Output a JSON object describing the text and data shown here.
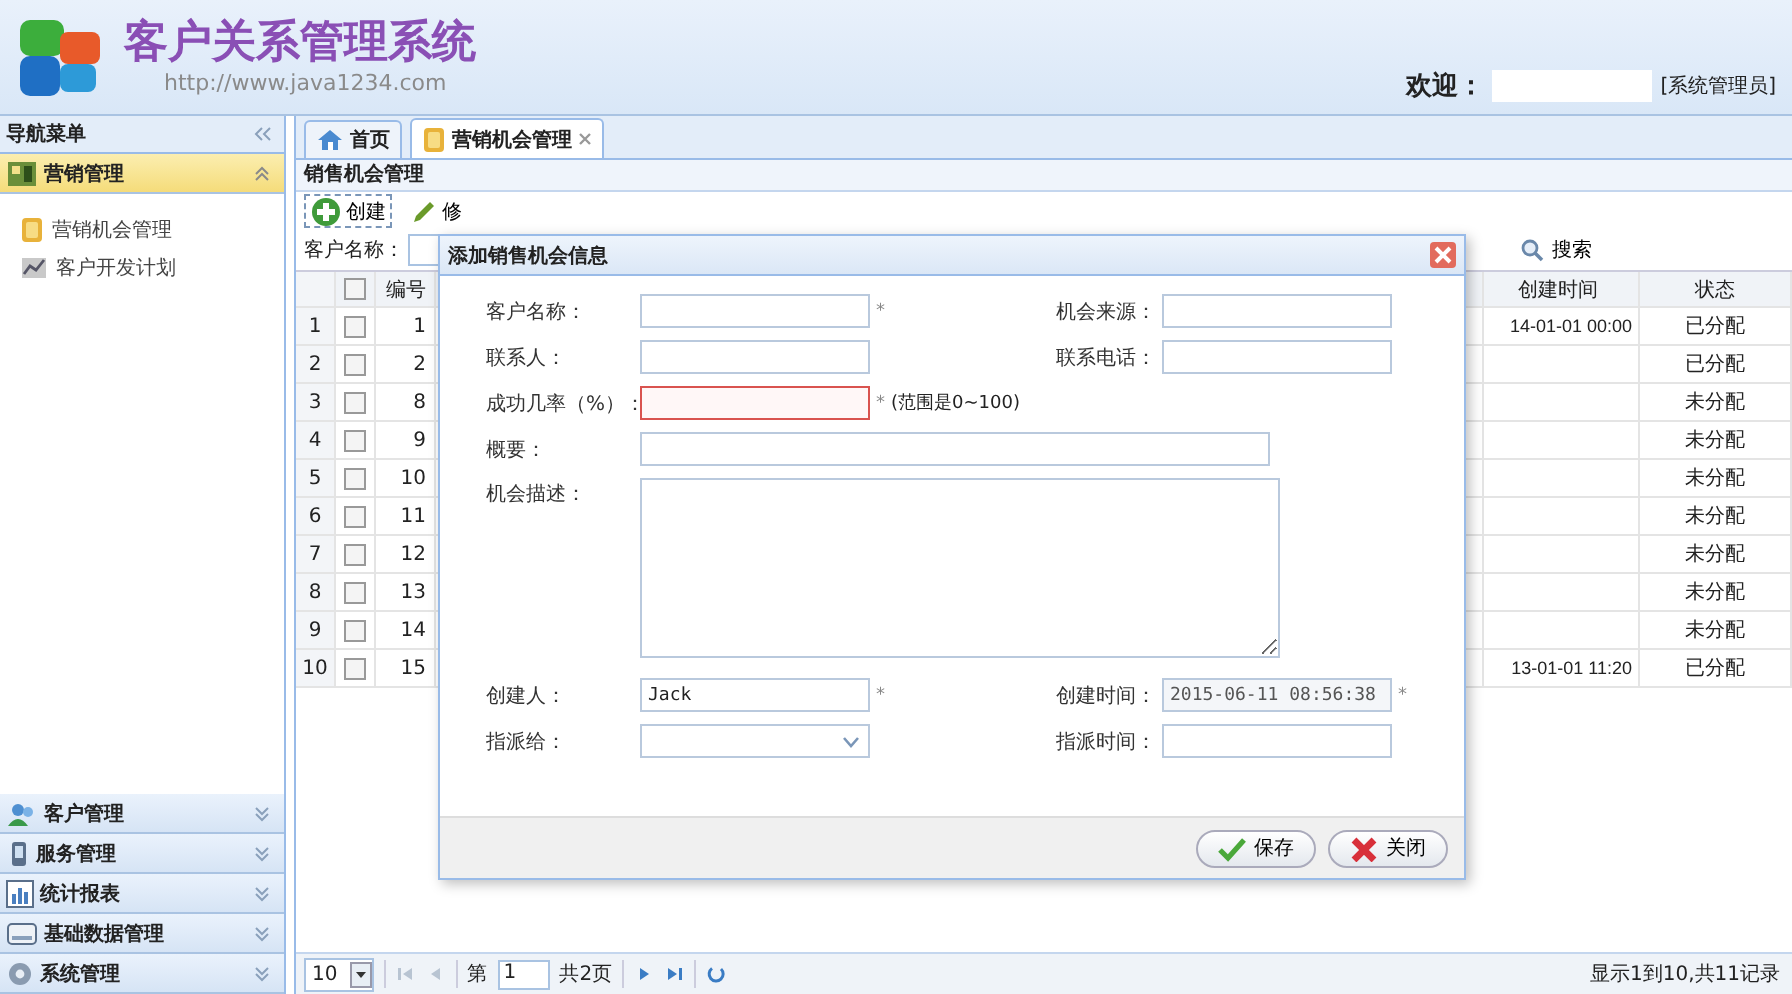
{
  "header": {
    "title": "客户关系管理系统",
    "url": "http://www.java1234.com",
    "welcome_label": "欢迎：",
    "user_role": "[系统管理员]"
  },
  "sidebar": {
    "title": "导航菜单",
    "sections": [
      {
        "label": "营销管理",
        "expanded": true,
        "items": [
          {
            "label": "营销机会管理"
          },
          {
            "label": "客户开发计划"
          }
        ]
      },
      {
        "label": "客户管理",
        "expanded": false
      },
      {
        "label": "服务管理",
        "expanded": false
      },
      {
        "label": "统计报表",
        "expanded": false
      },
      {
        "label": "基础数据管理",
        "expanded": false
      },
      {
        "label": "系统管理",
        "expanded": false
      }
    ]
  },
  "tabs": [
    {
      "label": "首页",
      "selected": false,
      "closable": false
    },
    {
      "label": "营销机会管理",
      "selected": true,
      "closable": true
    }
  ],
  "panel": {
    "title": "销售机会管理",
    "toolbar": [
      {
        "label": "创建"
      },
      {
        "label": "修"
      }
    ],
    "search": {
      "label": "客户名称：",
      "button": "搜索"
    },
    "table": {
      "header_checked": false,
      "columns": [
        "编号",
        "创建时间",
        "状态"
      ],
      "rows": [
        {
          "index": "1",
          "checked": false,
          "id": "1",
          "created": "14-01-01 00:00",
          "status": "已分配"
        },
        {
          "index": "2",
          "checked": false,
          "id": "2",
          "status": "已分配"
        },
        {
          "index": "3",
          "checked": false,
          "id": "8",
          "status": "未分配"
        },
        {
          "index": "4",
          "checked": false,
          "id": "9",
          "status": "未分配"
        },
        {
          "index": "5",
          "checked": false,
          "id": "10",
          "status": "未分配"
        },
        {
          "index": "6",
          "checked": false,
          "id": "11",
          "status": "未分配"
        },
        {
          "index": "7",
          "checked": false,
          "id": "12",
          "status": "未分配"
        },
        {
          "index": "8",
          "checked": false,
          "id": "13",
          "status": "未分配"
        },
        {
          "index": "9",
          "checked": false,
          "id": "14",
          "status": "未分配"
        },
        {
          "index": "10",
          "checked": false,
          "id": "15",
          "created": "13-01-01 11:20",
          "status": "已分配"
        }
      ]
    },
    "pager": {
      "page_size": "10",
      "page_prefix": "第",
      "page": "1",
      "page_total": "共2页",
      "info": "显示1到10,共11记录"
    }
  },
  "dialog": {
    "title": "添加销售机会信息",
    "fields": [
      {
        "label": "客户名称：",
        "kind": "text",
        "required_mark": "*",
        "invalid": false
      },
      {
        "label": "机会来源：",
        "kind": "text",
        "invalid": false
      },
      {
        "label": "联系人：",
        "kind": "text",
        "invalid": false
      },
      {
        "label": "联系电话：",
        "kind": "text",
        "invalid": false
      },
      {
        "label": "成功几率（%）：",
        "kind": "text",
        "required_mark": "*",
        "invalid": true,
        "note": "(范围是0~100)"
      },
      {
        "label": "概要：",
        "kind": "wide",
        "invalid": false
      },
      {
        "label": "机会描述：",
        "kind": "textarea",
        "invalid": false
      },
      {
        "label": "创建人：",
        "kind": "text",
        "value": "Jack",
        "required_mark": "*",
        "invalid": false
      },
      {
        "label": "创建时间：",
        "kind": "text",
        "value": "2015-06-11 08:56:38",
        "readonly": true,
        "required_mark": "*",
        "invalid": false
      },
      {
        "label": "指派给：",
        "kind": "select",
        "invalid": false
      },
      {
        "label": "指派时间：",
        "kind": "text",
        "invalid": false
      }
    ],
    "buttons": [
      {
        "label": "保存",
        "kind": "save"
      },
      {
        "label": "关闭",
        "kind": "close"
      }
    ]
  }
}
